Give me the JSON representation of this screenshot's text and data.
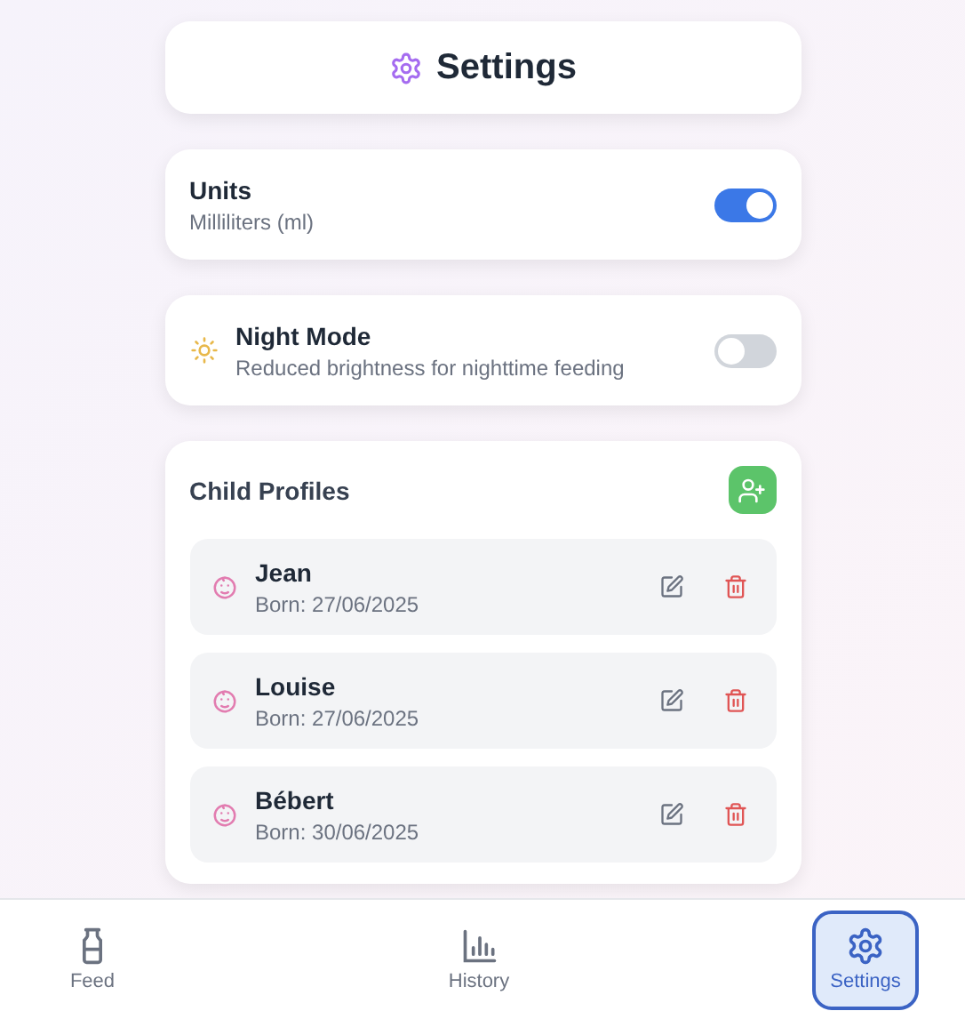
{
  "header": {
    "title": "Settings"
  },
  "units": {
    "label": "Units",
    "value": "Milliliters (ml)",
    "on": true
  },
  "night_mode": {
    "label": "Night Mode",
    "description": "Reduced brightness for nighttime feeding",
    "on": false
  },
  "child_profiles": {
    "title": "Child Profiles",
    "children": [
      {
        "name": "Jean",
        "born": "Born: 27/06/2025"
      },
      {
        "name": "Louise",
        "born": "Born: 27/06/2025"
      },
      {
        "name": "Bébert",
        "born": "Born: 30/06/2025"
      }
    ]
  },
  "nav": [
    {
      "label": "Feed",
      "selected": false
    },
    {
      "label": "History",
      "selected": false
    },
    {
      "label": "Settings",
      "selected": true
    }
  ]
}
